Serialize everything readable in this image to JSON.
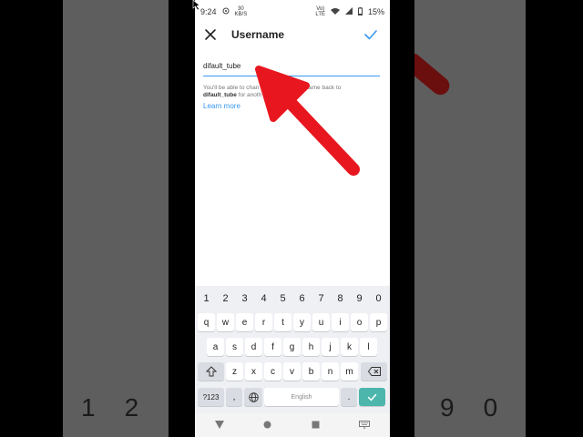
{
  "status": {
    "time": "9:24",
    "badge_top": "30",
    "badge_bottom": "KB/S",
    "net_top": "Vo)",
    "net_bottom": "LTE",
    "battery": "15%"
  },
  "header": {
    "title": "Username"
  },
  "username": {
    "value": "difault_tube"
  },
  "help": {
    "line1_start": "You'll be able to chan",
    "line1_end": "sername back to",
    "bold_name": "difault_tube",
    "line2_rest": "for anoth"
  },
  "learn_more": "Learn more",
  "keyboard": {
    "numbers": [
      "1",
      "2",
      "3",
      "4",
      "5",
      "6",
      "7",
      "8",
      "9",
      "0"
    ],
    "row1": [
      "q",
      "w",
      "e",
      "r",
      "t",
      "y",
      "u",
      "i",
      "o",
      "p"
    ],
    "row2": [
      "a",
      "s",
      "d",
      "f",
      "g",
      "h",
      "j",
      "k",
      "l"
    ],
    "row3": [
      "z",
      "x",
      "c",
      "v",
      "b",
      "n",
      "m"
    ],
    "sym": "?123",
    "comma": ",",
    "space": "English",
    "period": "."
  },
  "background": {
    "left_digits": [
      "1",
      "2"
    ],
    "right_digits": [
      "9",
      "0"
    ]
  },
  "colors": {
    "accent": "#3897f0",
    "arrow": "#e8171f",
    "enter": "#4db6ac"
  }
}
